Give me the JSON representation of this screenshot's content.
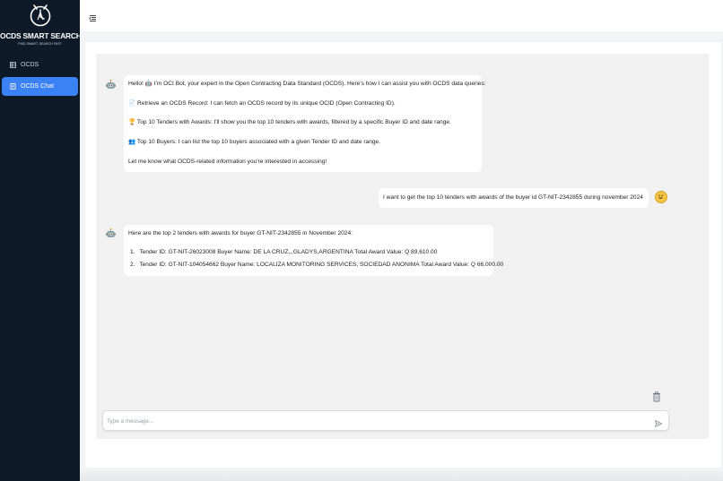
{
  "app": {
    "title": "OCDS SMART SEARCH",
    "tagline": "FIND SMART, SEARCH FAST"
  },
  "sidebar": {
    "items": [
      {
        "label": "OCDS",
        "icon": "table-icon",
        "active": false
      },
      {
        "label": "OCDS Chat",
        "icon": "document-icon",
        "active": true
      }
    ]
  },
  "chat": {
    "messages": [
      {
        "role": "bot",
        "lines": [
          "Hello! 🤖 I'm OCI Bot, your expert in the Open Contracting Data Standard (OCDS). Here's how I can assist you with OCDS data queries:",
          "📄 Retrieve an OCDS Record: I can fetch an OCDS record by its unique OCID (Open Contracting ID).",
          "🏆 Top 10 Tenders with Awards: I'll show you the top 10 tenders with awards, filtered by a specific Buyer ID and date range.",
          "👥 Top 10 Buyers: I can list the top 10 buyers associated with a given Tender ID and date range.",
          "Let me know what OCDS-related information you're interested in accessing!"
        ]
      },
      {
        "role": "user",
        "text": "I want to get the top 10 tenders with awards of the buyer id GT-NIT-2342855 during november 2024"
      },
      {
        "role": "bot",
        "intro": "Here are the top 2 tenders with awards for buyer GT-NIT-2342855 in November 2024:",
        "items": [
          {
            "number": "1.",
            "text": "Tender ID: GT-NIT-26023008 Buyer Name: DE LA CRUZ,,,GLADYS,ARGENTINA Total Award Value: Q 89,610.00"
          },
          {
            "number": "2.",
            "text": "Tender ID: GT-NIT-104054662 Buyer Name: LOCALIZA MONITORING SERVICES, SOCIEDAD ANONIMA Total Award Value: Q 66,000.00"
          }
        ]
      }
    ]
  },
  "input": {
    "placeholder": "Type a message...",
    "value": ""
  },
  "icons": {
    "menu": "menu-toggle-icon",
    "bot": "robot-icon",
    "user": "smiley-icon",
    "send": "send-icon",
    "trash": "trash-icon"
  },
  "colors": {
    "sidebar": "#0f1a28",
    "accent": "#3b82f6",
    "chat_background": "#f1f1f1"
  }
}
